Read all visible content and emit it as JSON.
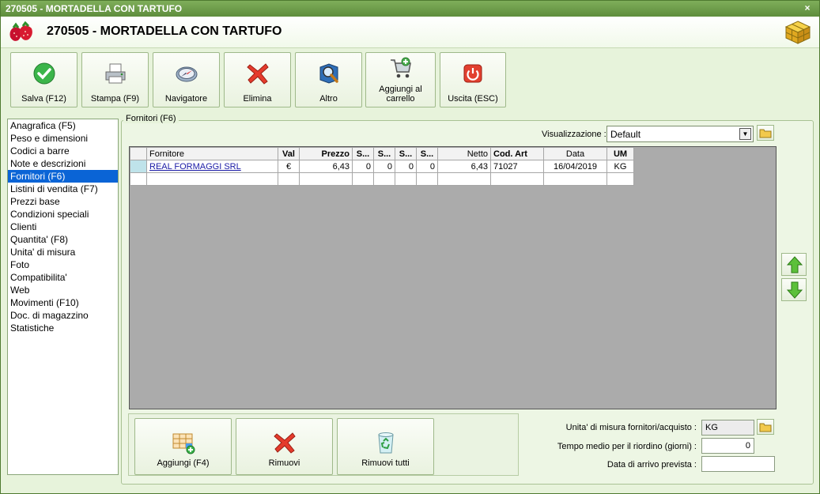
{
  "window": {
    "title": "270505 - MORTADELLA CON TARTUFO",
    "close_glyph": "×"
  },
  "header": {
    "title": "270505 - MORTADELLA CON TARTUFO",
    "logo_icon": "strawberry-icon",
    "app_icon": "cube-icon"
  },
  "toolbar": {
    "save": "Salva (F12)",
    "print": "Stampa (F9)",
    "navigator": "Navigatore",
    "delete": "Elimina",
    "other": "Altro",
    "add_cart_line1": "Aggiungi al",
    "add_cart_line2": "carrello",
    "exit": "Uscita (ESC)"
  },
  "sidebar": {
    "items": [
      {
        "label": "Anagrafica (F5)"
      },
      {
        "label": "Peso e dimensioni"
      },
      {
        "label": "Codici a barre"
      },
      {
        "label": "Note e descrizioni"
      },
      {
        "label": "Fornitori (F6)"
      },
      {
        "label": "Listini di vendita (F7)"
      },
      {
        "label": "Prezzi base"
      },
      {
        "label": "Condizioni speciali"
      },
      {
        "label": "Clienti"
      },
      {
        "label": "Quantita' (F8)"
      },
      {
        "label": "Unita' di misura"
      },
      {
        "label": "Foto"
      },
      {
        "label": "Compatibilita'"
      },
      {
        "label": "Web"
      },
      {
        "label": "Movimenti (F10)"
      },
      {
        "label": "Doc. di magazzino"
      },
      {
        "label": "Statistiche"
      }
    ],
    "active_index": 4
  },
  "suppliers": {
    "group_title": "Fornitori (F6)",
    "view_label": "Visualizzazione :",
    "view_value": "Default",
    "columns": [
      "Fornitore",
      "Val",
      "Prezzo",
      "S...",
      "S...",
      "S...",
      "S...",
      "Netto",
      "Cod. Art",
      "Data",
      "UM"
    ],
    "rows": [
      [
        "REAL FORMAGGI SRL",
        "€",
        "6,43",
        "0",
        "0",
        "0",
        "0",
        "6,43",
        "71027",
        "16/04/2019",
        "KG"
      ]
    ]
  },
  "bottom": {
    "add": "Aggiungi (F4)",
    "remove": "Rimuovi",
    "remove_all": "Rimuovi tutti"
  },
  "fields": {
    "um_label": "Unita' di misura fornitori/acquisto :",
    "um_value": "KG",
    "reorder_label": "Tempo medio per il riordino (giorni) :",
    "reorder_value": "0",
    "arrival_label": "Data di arrivo prevista :",
    "arrival_value": ""
  }
}
